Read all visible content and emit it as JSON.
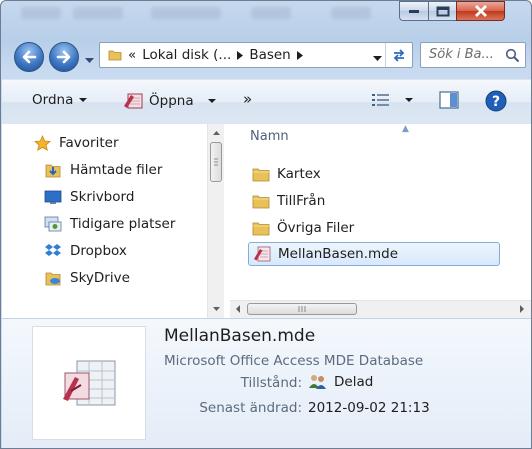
{
  "addressbar": {
    "overflow": "«",
    "segments": [
      "Lokal disk (...",
      "Basen"
    ]
  },
  "search": {
    "placeholder": "Sök i Ba..."
  },
  "toolbar": {
    "organize": "Ordna",
    "open": "Öppna",
    "more": "»"
  },
  "navpane": {
    "favorites": "Favoriter",
    "items": [
      {
        "label": "Hämtade filer",
        "icon": "downloads-icon"
      },
      {
        "label": "Skrivbord",
        "icon": "desktop-icon"
      },
      {
        "label": "Tidigare platser",
        "icon": "recent-places-icon"
      },
      {
        "label": "Dropbox",
        "icon": "dropbox-icon"
      },
      {
        "label": "SkyDrive",
        "icon": "skydrive-icon"
      }
    ]
  },
  "filelist": {
    "column_name": "Namn",
    "items": [
      {
        "label": "Kartex",
        "type": "folder"
      },
      {
        "label": "TillFrån",
        "type": "folder"
      },
      {
        "label": "Övriga Filer",
        "type": "folder"
      },
      {
        "label": "MellanBasen.mde",
        "type": "access-mde",
        "selected": true
      }
    ]
  },
  "details": {
    "filename": "MellanBasen.mde",
    "filetype": "Microsoft Office Access MDE Database",
    "state_label": "Tillstånd:",
    "state_value": "Delad",
    "modified_label": "Senast ändrad:",
    "modified_value": "2012-09-02 21:13"
  },
  "colors": {
    "accent": "#3d76c2",
    "selection": "#d7e8fc",
    "close_button": "#c0391f"
  }
}
